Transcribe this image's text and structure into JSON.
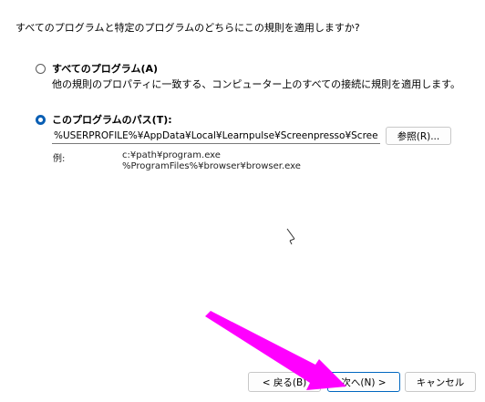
{
  "question": "すべてのプログラムと特定のプログラムのどちらにこの規則を適用しますか?",
  "options": [
    {
      "label": "すべてのプログラム(A)",
      "description": "他の規則のプロパティに一致する、コンピューター上のすべての接続に規則を適用します。",
      "selected": false
    },
    {
      "label": "このプログラムのパス(T):",
      "selected": true
    }
  ],
  "path_field": {
    "value": "%USERPROFILE%¥AppData¥Local¥Learnpulse¥Screenpresso¥Screenpresso.exe"
  },
  "browse_button": "参照(R)...",
  "example": {
    "label": "例:",
    "line1": "c:¥path¥program.exe",
    "line2": "%ProgramFiles%¥browser¥browser.exe"
  },
  "buttons": {
    "back": "< 戻る(B)",
    "next": "次へ(N) >",
    "cancel": "キャンセル"
  },
  "colors": {
    "accent": "#0a5fb4",
    "arrow": "#ff00ff"
  },
  "icons": {
    "cursor": "mouse-pointer-icon"
  }
}
